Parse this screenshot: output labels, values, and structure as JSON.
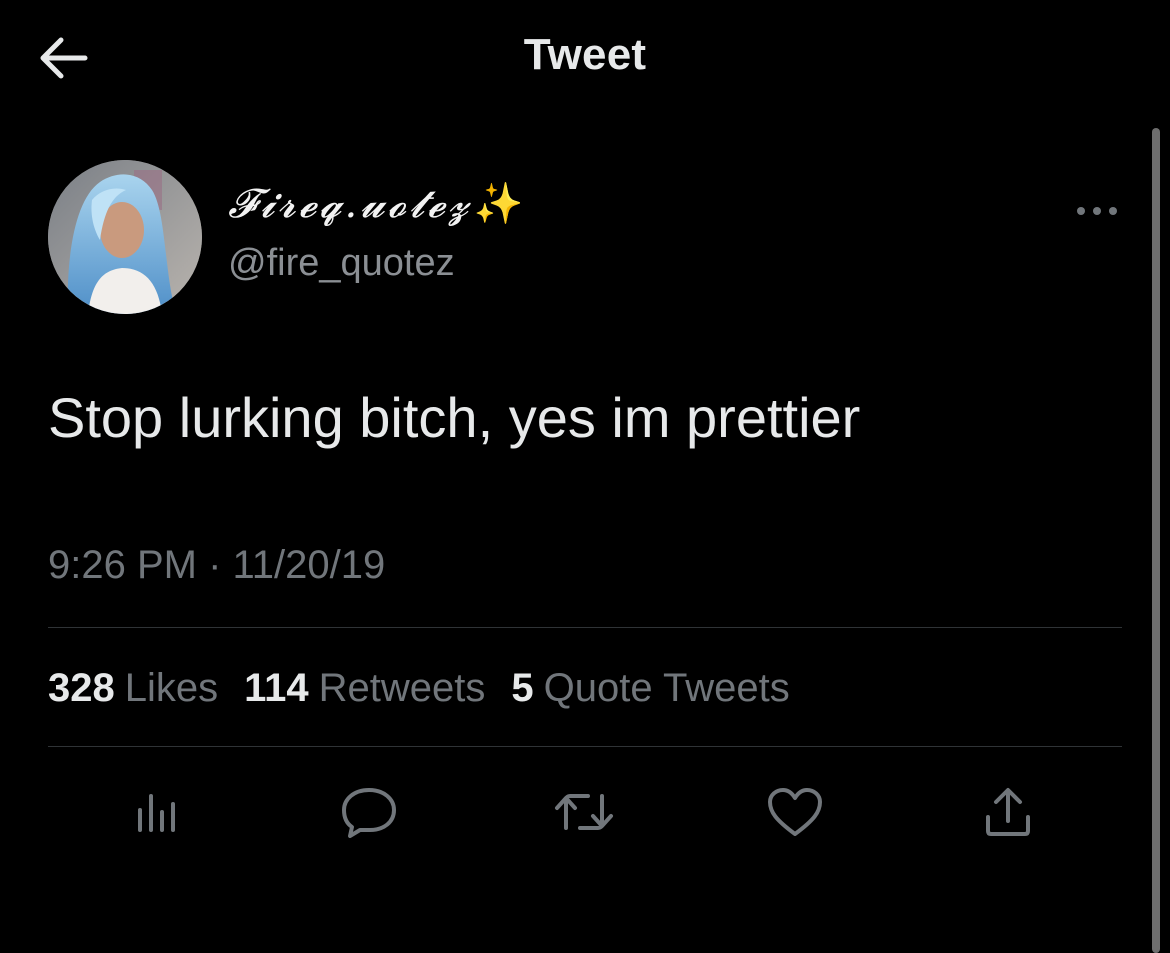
{
  "header": {
    "title": "Tweet",
    "back_icon": "arrow-left-icon"
  },
  "author": {
    "display_name": "𝓕𝓲𝓻𝓮𝓺.𝓾𝓸𝓽𝓮𝔃",
    "display_name_emoji": "✨",
    "handle": "@fire_quotez"
  },
  "tweet": {
    "text": "Stop lurking bitch, yes im prettier",
    "timestamp": "9:26 PM · 11/20/19"
  },
  "stats": {
    "likes_count": "328",
    "likes_label": "Likes",
    "retweets_count": "114",
    "retweets_label": "Retweets",
    "quotes_count": "5",
    "quotes_label": "Quote Tweets"
  },
  "actions": [
    "analytics-icon",
    "reply-icon",
    "retweet-icon",
    "like-icon",
    "share-icon"
  ],
  "colors": {
    "background": "#000000",
    "text_primary": "#e7e9ea",
    "text_secondary": "#71767b",
    "divider": "#2f3336",
    "sparkle": "#f4c430"
  }
}
